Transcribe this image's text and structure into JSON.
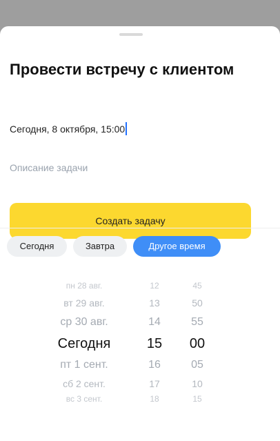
{
  "task": {
    "title": "Провести встречу с клиентом",
    "datetime_value": "Сегодня, 8 октября, 15:00",
    "description_placeholder": "Описание задачи",
    "create_label": "Создать задачу"
  },
  "chips": [
    {
      "label": "Сегодня",
      "active": false
    },
    {
      "label": "Завтра",
      "active": false
    },
    {
      "label": "Другое время",
      "active": true
    }
  ],
  "picker": {
    "days": [
      "пн 28 авг.",
      "вт 29 авг.",
      "ср 30 авг.",
      "Сегодня",
      "пт 1 сент.",
      "сб 2 сент.",
      "вс 3 сент."
    ],
    "hours": [
      "12",
      "13",
      "14",
      "15",
      "16",
      "17",
      "18"
    ],
    "minutes": [
      "45",
      "50",
      "55",
      "00",
      "05",
      "10",
      "15"
    ],
    "selected_day": "Сегодня",
    "selected_hour": "15",
    "selected_minute": "00"
  },
  "colors": {
    "accent_yellow": "#fcd82f",
    "accent_blue": "#3f8ef7",
    "caret_blue": "#1f6fff"
  }
}
